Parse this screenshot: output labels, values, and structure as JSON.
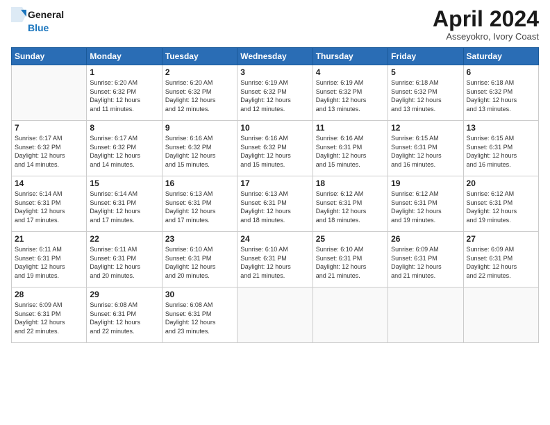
{
  "header": {
    "logo_line1": "General",
    "logo_line2": "Blue",
    "month_title": "April 2024",
    "location": "Asseyokro, Ivory Coast"
  },
  "days_of_week": [
    "Sunday",
    "Monday",
    "Tuesday",
    "Wednesday",
    "Thursday",
    "Friday",
    "Saturday"
  ],
  "weeks": [
    [
      {
        "day": "",
        "info": ""
      },
      {
        "day": "1",
        "info": "Sunrise: 6:20 AM\nSunset: 6:32 PM\nDaylight: 12 hours\nand 11 minutes."
      },
      {
        "day": "2",
        "info": "Sunrise: 6:20 AM\nSunset: 6:32 PM\nDaylight: 12 hours\nand 12 minutes."
      },
      {
        "day": "3",
        "info": "Sunrise: 6:19 AM\nSunset: 6:32 PM\nDaylight: 12 hours\nand 12 minutes."
      },
      {
        "day": "4",
        "info": "Sunrise: 6:19 AM\nSunset: 6:32 PM\nDaylight: 12 hours\nand 13 minutes."
      },
      {
        "day": "5",
        "info": "Sunrise: 6:18 AM\nSunset: 6:32 PM\nDaylight: 12 hours\nand 13 minutes."
      },
      {
        "day": "6",
        "info": "Sunrise: 6:18 AM\nSunset: 6:32 PM\nDaylight: 12 hours\nand 13 minutes."
      }
    ],
    [
      {
        "day": "7",
        "info": "Sunrise: 6:17 AM\nSunset: 6:32 PM\nDaylight: 12 hours\nand 14 minutes."
      },
      {
        "day": "8",
        "info": "Sunrise: 6:17 AM\nSunset: 6:32 PM\nDaylight: 12 hours\nand 14 minutes."
      },
      {
        "day": "9",
        "info": "Sunrise: 6:16 AM\nSunset: 6:32 PM\nDaylight: 12 hours\nand 15 minutes."
      },
      {
        "day": "10",
        "info": "Sunrise: 6:16 AM\nSunset: 6:32 PM\nDaylight: 12 hours\nand 15 minutes."
      },
      {
        "day": "11",
        "info": "Sunrise: 6:16 AM\nSunset: 6:31 PM\nDaylight: 12 hours\nand 15 minutes."
      },
      {
        "day": "12",
        "info": "Sunrise: 6:15 AM\nSunset: 6:31 PM\nDaylight: 12 hours\nand 16 minutes."
      },
      {
        "day": "13",
        "info": "Sunrise: 6:15 AM\nSunset: 6:31 PM\nDaylight: 12 hours\nand 16 minutes."
      }
    ],
    [
      {
        "day": "14",
        "info": "Sunrise: 6:14 AM\nSunset: 6:31 PM\nDaylight: 12 hours\nand 17 minutes."
      },
      {
        "day": "15",
        "info": "Sunrise: 6:14 AM\nSunset: 6:31 PM\nDaylight: 12 hours\nand 17 minutes."
      },
      {
        "day": "16",
        "info": "Sunrise: 6:13 AM\nSunset: 6:31 PM\nDaylight: 12 hours\nand 17 minutes."
      },
      {
        "day": "17",
        "info": "Sunrise: 6:13 AM\nSunset: 6:31 PM\nDaylight: 12 hours\nand 18 minutes."
      },
      {
        "day": "18",
        "info": "Sunrise: 6:12 AM\nSunset: 6:31 PM\nDaylight: 12 hours\nand 18 minutes."
      },
      {
        "day": "19",
        "info": "Sunrise: 6:12 AM\nSunset: 6:31 PM\nDaylight: 12 hours\nand 19 minutes."
      },
      {
        "day": "20",
        "info": "Sunrise: 6:12 AM\nSunset: 6:31 PM\nDaylight: 12 hours\nand 19 minutes."
      }
    ],
    [
      {
        "day": "21",
        "info": "Sunrise: 6:11 AM\nSunset: 6:31 PM\nDaylight: 12 hours\nand 19 minutes."
      },
      {
        "day": "22",
        "info": "Sunrise: 6:11 AM\nSunset: 6:31 PM\nDaylight: 12 hours\nand 20 minutes."
      },
      {
        "day": "23",
        "info": "Sunrise: 6:10 AM\nSunset: 6:31 PM\nDaylight: 12 hours\nand 20 minutes."
      },
      {
        "day": "24",
        "info": "Sunrise: 6:10 AM\nSunset: 6:31 PM\nDaylight: 12 hours\nand 21 minutes."
      },
      {
        "day": "25",
        "info": "Sunrise: 6:10 AM\nSunset: 6:31 PM\nDaylight: 12 hours\nand 21 minutes."
      },
      {
        "day": "26",
        "info": "Sunrise: 6:09 AM\nSunset: 6:31 PM\nDaylight: 12 hours\nand 21 minutes."
      },
      {
        "day": "27",
        "info": "Sunrise: 6:09 AM\nSunset: 6:31 PM\nDaylight: 12 hours\nand 22 minutes."
      }
    ],
    [
      {
        "day": "28",
        "info": "Sunrise: 6:09 AM\nSunset: 6:31 PM\nDaylight: 12 hours\nand 22 minutes."
      },
      {
        "day": "29",
        "info": "Sunrise: 6:08 AM\nSunset: 6:31 PM\nDaylight: 12 hours\nand 22 minutes."
      },
      {
        "day": "30",
        "info": "Sunrise: 6:08 AM\nSunset: 6:31 PM\nDaylight: 12 hours\nand 23 minutes."
      },
      {
        "day": "",
        "info": ""
      },
      {
        "day": "",
        "info": ""
      },
      {
        "day": "",
        "info": ""
      },
      {
        "day": "",
        "info": ""
      }
    ]
  ]
}
